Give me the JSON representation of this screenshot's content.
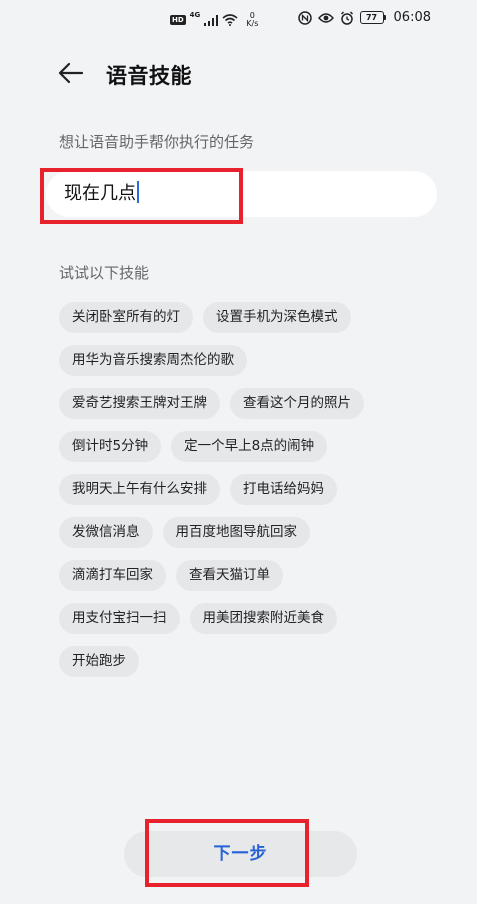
{
  "status_bar": {
    "hd": "HD",
    "network_type": "4G",
    "speed_value": "0",
    "speed_unit": "K/s",
    "battery": "77",
    "time": "06:08"
  },
  "header": {
    "title": "语音技能"
  },
  "task": {
    "label": "想让语音助手帮你执行的任务",
    "value": "现在几点"
  },
  "skills": {
    "label": "试试以下技能",
    "rows": [
      [
        "关闭卧室所有的灯",
        "设置手机为深色模式"
      ],
      [
        "用华为音乐搜索周杰伦的歌"
      ],
      [
        "爱奇艺搜索王牌对王牌",
        "查看这个月的照片"
      ],
      [
        "倒计时5分钟",
        "定一个早上8点的闹钟"
      ],
      [
        "我明天上午有什么安排",
        "打电话给妈妈"
      ],
      [
        "发微信消息",
        "用百度地图导航回家"
      ],
      [
        "滴滴打车回家",
        "查看天猫订单"
      ],
      [
        "用支付宝扫一扫",
        "用美团搜索附近美食"
      ],
      [
        "开始跑步"
      ]
    ]
  },
  "footer": {
    "next_label": "下一步"
  },
  "colors": {
    "accent": "#2762d6",
    "highlight": "#e8222c",
    "background": "#f1f3f5"
  }
}
